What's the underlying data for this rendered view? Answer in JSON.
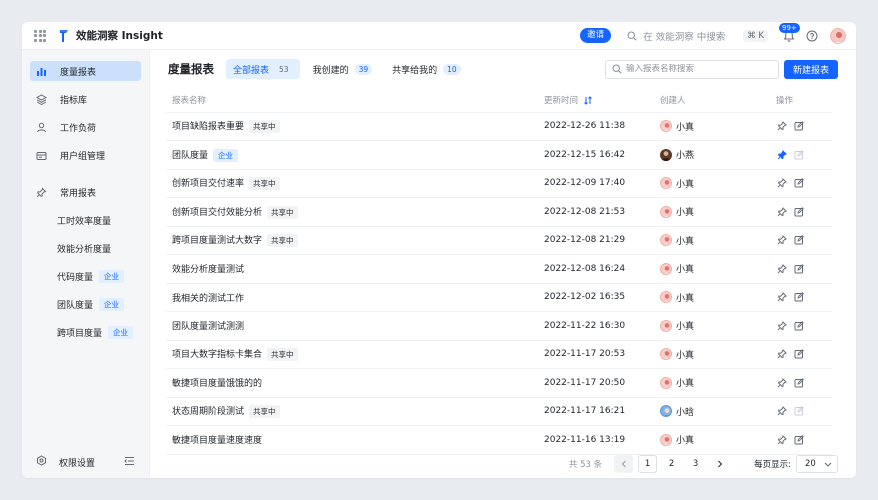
{
  "topbar": {
    "app_title": "效能洞察 Insight",
    "invite_label": "邀请",
    "search_placeholder": "在 效能洞察 中搜索",
    "shortcut": "⌘ K",
    "notification_count": "99+"
  },
  "sidebar": {
    "items": [
      {
        "label": "度量报表",
        "icon": "chart-icon",
        "active": true
      },
      {
        "label": "指标库",
        "icon": "layers-icon",
        "active": false
      },
      {
        "label": "工作负荷",
        "icon": "user-icon",
        "active": false
      },
      {
        "label": "用户组管理",
        "icon": "folder-icon",
        "active": false
      }
    ],
    "favorites_label": "常用报表",
    "favorites": [
      {
        "label": "工时效率度量",
        "tag": ""
      },
      {
        "label": "效能分析度量",
        "tag": ""
      },
      {
        "label": "代码度量",
        "tag": "企业"
      },
      {
        "label": "团队度量",
        "tag": "企业"
      },
      {
        "label": "跨项目度量",
        "tag": "企业"
      }
    ],
    "settings_label": "权限设置"
  },
  "main": {
    "title": "度量报表",
    "tabs": [
      {
        "label": "全部报表",
        "count": "53",
        "active": true
      },
      {
        "label": "我创建的",
        "count": "39",
        "active": false
      },
      {
        "label": "共享给我的",
        "count": "10",
        "active": false
      }
    ],
    "search_placeholder": "输入报表名称搜索",
    "new_button": "新建报表",
    "columns": {
      "name": "报表名称",
      "time": "更新时间",
      "creator": "创建人",
      "ops": "操作"
    },
    "rows": [
      {
        "name": "项目缺陷报表重要",
        "tag": "共享中",
        "tag_type": "shared",
        "time": "2022-12-26 11:38",
        "creator": "小真",
        "avatar": "pink",
        "pinned": false,
        "editable": true
      },
      {
        "name": "团队度量",
        "tag": "企业",
        "tag_type": "team",
        "time": "2022-12-15 16:42",
        "creator": "小燕",
        "avatar": "dark",
        "pinned": true,
        "editable": false
      },
      {
        "name": "创新项目交付速率",
        "tag": "共享中",
        "tag_type": "shared",
        "time": "2022-12-09 17:40",
        "creator": "小真",
        "avatar": "pink",
        "pinned": false,
        "editable": true
      },
      {
        "name": "创新项目交付效能分析",
        "tag": "共享中",
        "tag_type": "shared",
        "time": "2022-12-08 21:53",
        "creator": "小真",
        "avatar": "pink",
        "pinned": false,
        "editable": true
      },
      {
        "name": "跨项目度量测试大数字",
        "tag": "共享中",
        "tag_type": "shared",
        "time": "2022-12-08 21:29",
        "creator": "小真",
        "avatar": "pink",
        "pinned": false,
        "editable": true
      },
      {
        "name": "效能分析度量测试",
        "tag": "",
        "tag_type": "",
        "time": "2022-12-08 16:24",
        "creator": "小真",
        "avatar": "pink",
        "pinned": false,
        "editable": true
      },
      {
        "name": "我相关的测试工作",
        "tag": "",
        "tag_type": "",
        "time": "2022-12-02 16:35",
        "creator": "小真",
        "avatar": "pink",
        "pinned": false,
        "editable": true
      },
      {
        "name": "团队度量测试测测",
        "tag": "",
        "tag_type": "",
        "time": "2022-11-22 16:30",
        "creator": "小真",
        "avatar": "pink",
        "pinned": false,
        "editable": true
      },
      {
        "name": "项目大数字指标卡集合",
        "tag": "共享中",
        "tag_type": "shared",
        "time": "2022-11-17 20:53",
        "creator": "小真",
        "avatar": "pink",
        "pinned": false,
        "editable": true
      },
      {
        "name": "敏捷项目度量饿饿的的",
        "tag": "",
        "tag_type": "",
        "time": "2022-11-17 20:50",
        "creator": "小真",
        "avatar": "pink",
        "pinned": false,
        "editable": true
      },
      {
        "name": "状态周期阶段测试",
        "tag": "共享中",
        "tag_type": "shared",
        "time": "2022-11-17 16:21",
        "creator": "小晗",
        "avatar": "blue",
        "pinned": false,
        "editable": false
      },
      {
        "name": "敏捷项目度量速度速度",
        "tag": "",
        "tag_type": "",
        "time": "2022-11-16 13:19",
        "creator": "小真",
        "avatar": "pink",
        "pinned": false,
        "editable": true
      }
    ]
  },
  "pagination": {
    "total": "共 53 条",
    "pages": [
      "1",
      "2",
      "3"
    ],
    "current": "1",
    "per_page_label": "每页显示:",
    "page_size": "20"
  },
  "colors": {
    "accent": "#1664ff",
    "active_nav": "#cbe1fb",
    "sidebar_bg": "#f5f6f7"
  }
}
